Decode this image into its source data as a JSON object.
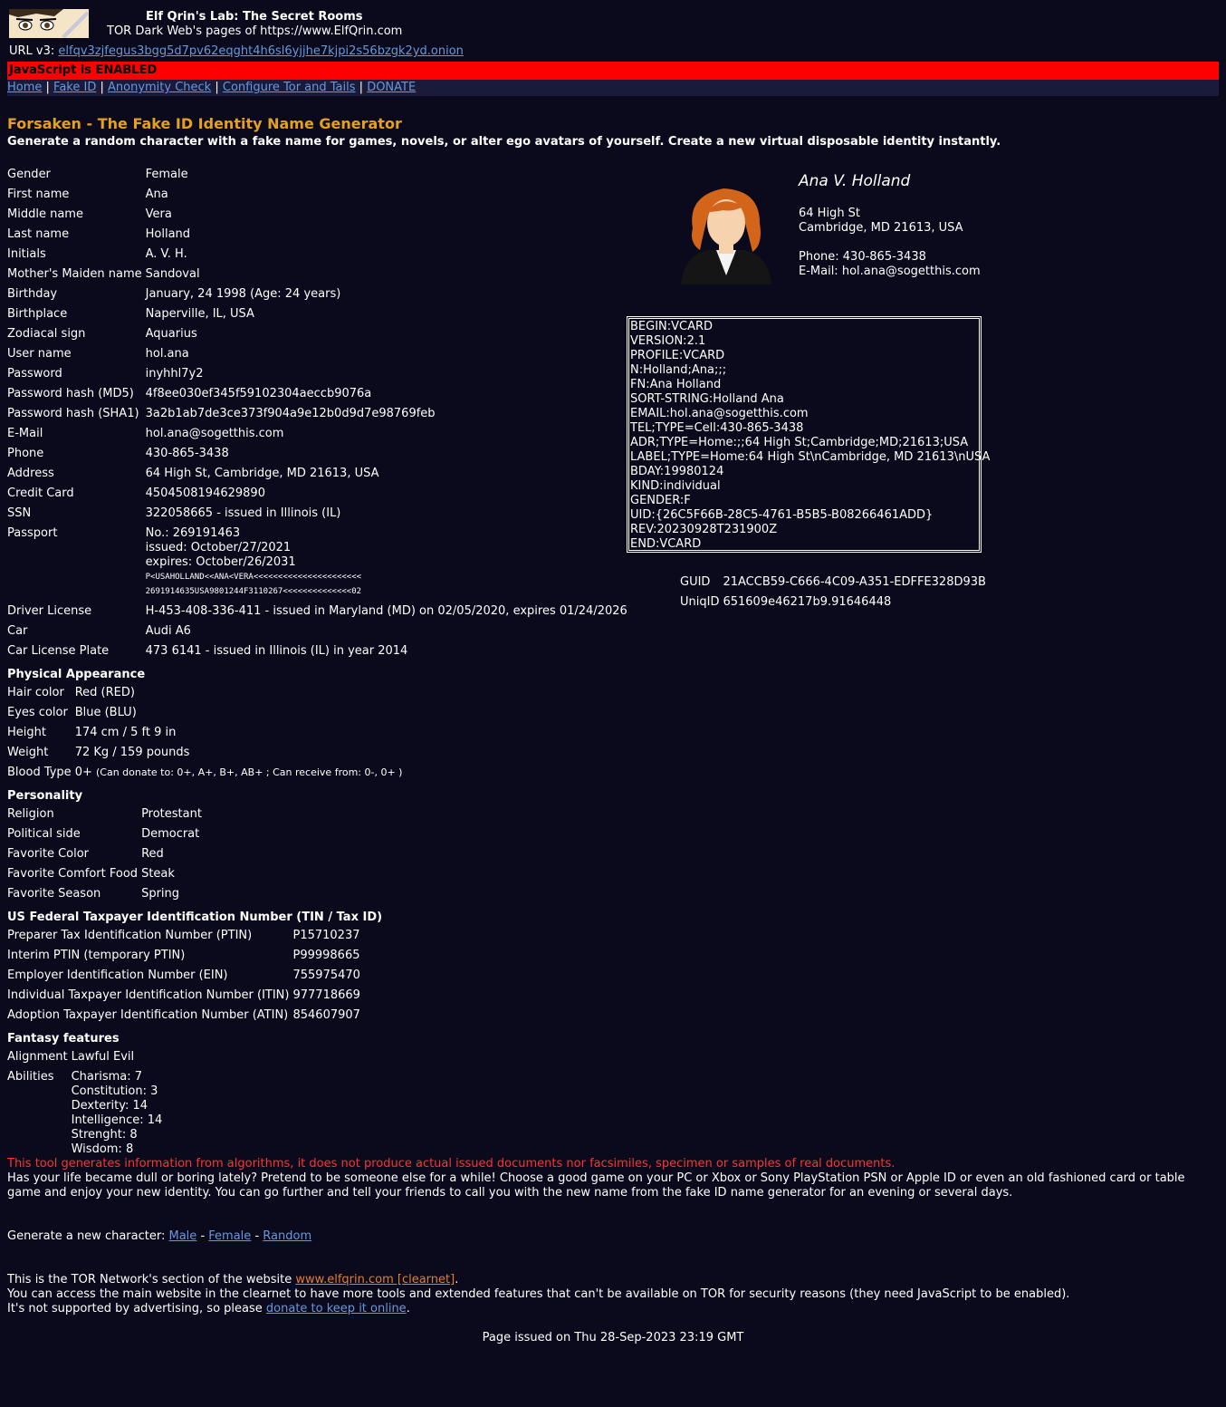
{
  "header": {
    "title": "Elf Qrin's Lab: The Secret Rooms",
    "subtitle": "TOR Dark Web's pages of https://www.ElfQrin.com",
    "url_label": "URL v3:",
    "url_value": "elfqv3zjfegus3bgg5d7pv62eqght4h6sl6yjjhe7kjpi2s56bzgk2yd.onion",
    "js_status": "JavaScript is ENABLED"
  },
  "nav": [
    {
      "label": "Home"
    },
    {
      "label": "Fake ID"
    },
    {
      "label": "Anonymity Check"
    },
    {
      "label": "Configure Tor and Tails"
    },
    {
      "label": "DONATE"
    }
  ],
  "page": {
    "title": "Forsaken - The Fake ID Identity Name Generator",
    "subtitle": "Generate a random character with a fake name for games, novels, or alter ego avatars of yourself. Create a new virtual disposable identity instantly."
  },
  "identity": [
    {
      "label": "Gender",
      "value": "Female"
    },
    {
      "label": "First name",
      "value": "Ana"
    },
    {
      "label": "Middle name",
      "value": "Vera"
    },
    {
      "label": "Last name",
      "value": "Holland"
    },
    {
      "label": "Initials",
      "value": "A. V. H."
    },
    {
      "label": "Mother's Maiden name",
      "value": "Sandoval"
    },
    {
      "label": "Birthday",
      "value": "January, 24 1998 (Age: 24 years)"
    },
    {
      "label": "Birthplace",
      "value": "Naperville, IL, USA"
    },
    {
      "label": "Zodiacal sign",
      "value": "Aquarius"
    },
    {
      "label": "User name",
      "value": "hol.ana"
    },
    {
      "label": "Password",
      "value": "inyhhl7y2"
    },
    {
      "label": "Password hash (MD5)",
      "value": "4f8ee030ef345f59102304aeccb9076a"
    },
    {
      "label": "Password hash (SHA1)",
      "value": "3a2b1ab7de3ce373f904a9e12b0d9d7e98769feb"
    },
    {
      "label": "E-Mail",
      "value": "hol.ana@sogetthis.com"
    },
    {
      "label": "Phone",
      "value": "430-865-3438"
    },
    {
      "label": "Address",
      "value": "64 High St, Cambridge, MD 21613, USA"
    },
    {
      "label": "Credit Card",
      "value": "4504508194629890"
    },
    {
      "label": "SSN",
      "value": "322058665 - issued in Illinois (IL)"
    }
  ],
  "passport": {
    "label": "Passport",
    "number": "No.: 269191463",
    "issued": "issued: October/27/2021",
    "expires": "expires: October/26/2031",
    "mrz1": "P<USAHOLLAND<<ANA<VERA<<<<<<<<<<<<<<<<<<<<<<",
    "mrz2": "2691914635USA9801244F3110267<<<<<<<<<<<<<<02"
  },
  "identity2": [
    {
      "label": "Driver License",
      "value": "H-453-408-336-411 - issued in Maryland (MD) on 02/05/2020, expires 01/24/2026"
    },
    {
      "label": "Car",
      "value": "Audi A6"
    },
    {
      "label": "Car License Plate",
      "value": "473 6141 - issued in Illinois (IL) in year 2014"
    }
  ],
  "physical": {
    "title": "Physical Appearance",
    "rows": [
      {
        "label": "Hair color",
        "value": "Red (RED)"
      },
      {
        "label": "Eyes color",
        "value": "Blue (BLU)"
      },
      {
        "label": "Height",
        "value": "174 cm / 5 ft 9 in"
      },
      {
        "label": "Weight",
        "value": "72 Kg / 159 pounds"
      }
    ],
    "blood_label": "Blood Type",
    "blood_value": "0+",
    "blood_note": "(Can donate to: 0+, A+, B+, AB+ ; Can receive from: 0-, 0+ )"
  },
  "personality": {
    "title": "Personality",
    "rows": [
      {
        "label": "Religion",
        "value": "Protestant"
      },
      {
        "label": "Political side",
        "value": "Democrat"
      },
      {
        "label": "Favorite Color",
        "value": "Red"
      },
      {
        "label": "Favorite Comfort Food",
        "value": "Steak"
      },
      {
        "label": "Favorite Season",
        "value": "Spring"
      }
    ]
  },
  "tax": {
    "title": "US Federal Taxpayer Identification Number (TIN / Tax ID)",
    "rows": [
      {
        "label": "Preparer Tax Identification Number (PTIN)",
        "value": "P15710237"
      },
      {
        "label": "Interim PTIN (temporary PTIN)",
        "value": "P99998665"
      },
      {
        "label": "Employer Identification Number (EIN)",
        "value": "755975470"
      },
      {
        "label": "Individual Taxpayer Identification Number (ITIN)",
        "value": "977718669"
      },
      {
        "label": "Adoption Taxpayer Identification Number (ATIN)",
        "value": "854607907"
      }
    ]
  },
  "fantasy": {
    "title": "Fantasy features",
    "alignment_label": "Alignment",
    "alignment_value": "Lawful Evil",
    "abilities_label": "Abilities",
    "abilities": [
      "Charisma: 7",
      "Constitution: 3",
      "Dexterity: 14",
      "Intelligence: 14",
      "Strenght: 8",
      "Wisdom: 8"
    ]
  },
  "card": {
    "name": "Ana V. Holland",
    "street": "64 High St",
    "city": "Cambridge, MD 21613, USA",
    "phone": "Phone: 430-865-3438",
    "email": "E-Mail: hol.ana@sogetthis.com"
  },
  "vcard": [
    "BEGIN:VCARD",
    "VERSION:2.1",
    "PROFILE:VCARD",
    "N:Holland;Ana;;;",
    "FN:Ana Holland",
    "SORT-STRING:Holland Ana",
    "EMAIL:hol.ana@sogetthis.com",
    "TEL;TYPE=Cell:430-865-3438",
    "ADR;TYPE=Home:;;64 High St;Cambridge;MD;21613;USA",
    "LABEL;TYPE=Home:64 High St\\nCambridge, MD 21613\\nUSA",
    "BDAY:19980124",
    "KIND:individual",
    "GENDER:F",
    "UID:{26C5F66B-28C5-4761-B5B5-B08266461ADD}",
    "REV:20230928T231900Z",
    "END:VCARD"
  ],
  "ids": [
    {
      "label": "GUID",
      "value": "21ACCB59-C666-4C09-A351-EDFFE328D93B"
    },
    {
      "label": "UniqID",
      "value": "651609e46217b9.91646448"
    }
  ],
  "disclaimer": "This tool generates information from algorithms, it does not produce actual issued documents nor facsimiles, specimen or samples of real documents.",
  "description": "Has your life became dull or boring lately? Pretend to be someone else for a while! Choose a good game on your PC or Xbox or Sony PlayStation PSN or Apple ID or even an old fashioned card or table game and enjoy your new identity. You can go further and tell your friends to call you with the new name from the fake ID name generator for an evening or several days.",
  "generate": {
    "prefix": "Generate a new character:",
    "male": "Male",
    "female": "Female",
    "random": "Random",
    "sep": "-"
  },
  "footer": {
    "line1_prefix": "This is the TOR Network's section of the website",
    "line1_link": "www.elfqrin.com [clearnet]",
    "line1_suffix": ".",
    "line2": "You can access the main website in the clearnet to have more tools and extended features that can't be available on TOR for security reasons (they need JavaScript to be enabled).",
    "line3_prefix": "It's not supported by advertising, so please",
    "line3_link": "donate to keep it online",
    "line3_suffix": ".",
    "issued": "Page issued on Thu 28-Sep-2023 23:19 GMT"
  }
}
